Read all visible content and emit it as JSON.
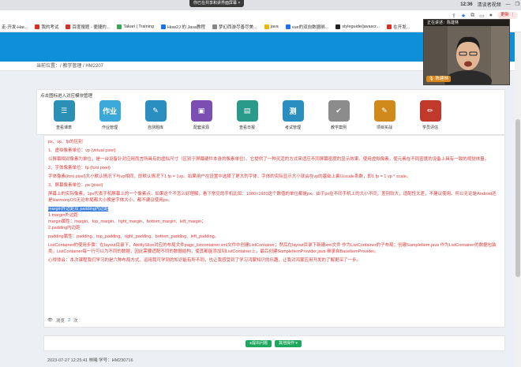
{
  "chrome": {
    "screen_share_banner": "你已在共享和讲界面屏幕 ×",
    "time": "12:36",
    "user": "清谈者视频",
    "update_label": "更新 ⋮",
    "bookmarks": [
      "走-开发-Har...",
      "我的考试",
      "百度搜题 - 便捷的...",
      "Takari | Training",
      "How2J 的 Java教程",
      "梦幻西游尽善尽美...",
      "java",
      "vue的双向数据绑...",
      "styleguide/javascr...",
      "在开发..."
    ]
  },
  "breadcrumb": "当前位置：/ 教学管理 / HM2207",
  "nav": {
    "heading": "点击图标进入对应模块管理",
    "items": [
      {
        "label": "查看课表",
        "glyph": "☰",
        "color": "#2c8fb5"
      },
      {
        "label": "作业管理",
        "glyph": "作业",
        "color": "#3aa8d8"
      },
      {
        "label": "自测题库",
        "glyph": "✎",
        "color": "#2a8fc0"
      },
      {
        "label": "配套资源",
        "glyph": "▣",
        "color": "#7a4fb1"
      },
      {
        "label": "查看日报",
        "glyph": "▤",
        "color": "#2a9a8a"
      },
      {
        "label": "考试管理",
        "glyph": "测",
        "color": "#2a8fc0"
      },
      {
        "label": "教学案例",
        "glyph": "✔",
        "color": "#8c8c8c"
      },
      {
        "label": "项目实战",
        "glyph": "✎",
        "color": "#d08a1c"
      },
      {
        "label": "学员评估",
        "glyph": "✏",
        "color": "#c0392b"
      }
    ]
  },
  "article": {
    "p1": "px、vp、fp的区别",
    "p2": "1、虚拟像素单位：vp (virtual pixel)",
    "p3": "以屏幕相对像素为单位，是一台设备针对应用而言所具有的虚拟尺寸（区别于屏幕硬件本身的像素单位）。它提供了一种灵活的方式来适应不同屏幕密度的显示效果。使用虚拟像素，使元素在不同密度的设备上具有一致的视觉体量。",
    "p4": "2、字体像素单位：fp (font pixel)",
    "p5": "字体像素(font pixel)大小默认情况下与vp相同，即默认情况下1 fp = 1vp。如果用户在设置中选择了更大的字体，字体的实际显示大小就会在vp的基础上乘以scale系数，即1 fp = 1 vp * scale。",
    "p6": "3、屏幕像素单位：px (pixel)",
    "p7": "屏幕上的实际像素，1px代表手机屏幕上的一个像素点。如果这个不怎么好理解，看下常见的手机比如：1080×1920这个数值的单位都是px。由于px在不同手机上的大小不同，差别较大，适配性太差，不建议使用。所以无论是Android还是HarmonyOS无论布局都大小换是字体大小，都不建议使用px。",
    "p8_highlight": "margin外边距及 padding内边距",
    "p9": "1.margin外边距",
    "p10": "margin属性：margin、top_margin、right_margin、bottom_margin、left_margin；",
    "p11": "2.padding内边距",
    "p12": "padding属性：padding、top_padding、right_padding、bottom_padding、left_padding。",
    "p13": "ListContainer的使用步骤：在layout目录下，AbilitySlice对应的布局文件page_listcontainer.xml文件中创建ListContainer；然后在layout目录下新建xml文件 作为ListContainer的子布局；创建SampleItem.java 作为ListContainer的数据包装类。ListContainer每一行可以为不同的数据，因此需要适配不同的数据结构，使其都能添加到ListContainer上，最后创建SampleItemProvider.java 继承自BaseItemProvider。",
    "p14": "心得体会：本次课程我们学习的是六种布局方式，运用我可学到的知识能有所不同，也让我感受到了学习鸿蒙知识的乐趣，让我对鸿蒙应用开发的了解更深了一步。"
  },
  "views": {
    "prefix": "浏览",
    "count": "2",
    "suffix": "次"
  },
  "actions": {
    "btn1": "●提出问题",
    "btn2": "其他操作 ▾"
  },
  "bottom_meta": "2023-07-27 12:25:41  林曦  学号：HM230716",
  "webcam": {
    "status": "正在讲述：陈建林",
    "name": "🎙 陈建林"
  }
}
